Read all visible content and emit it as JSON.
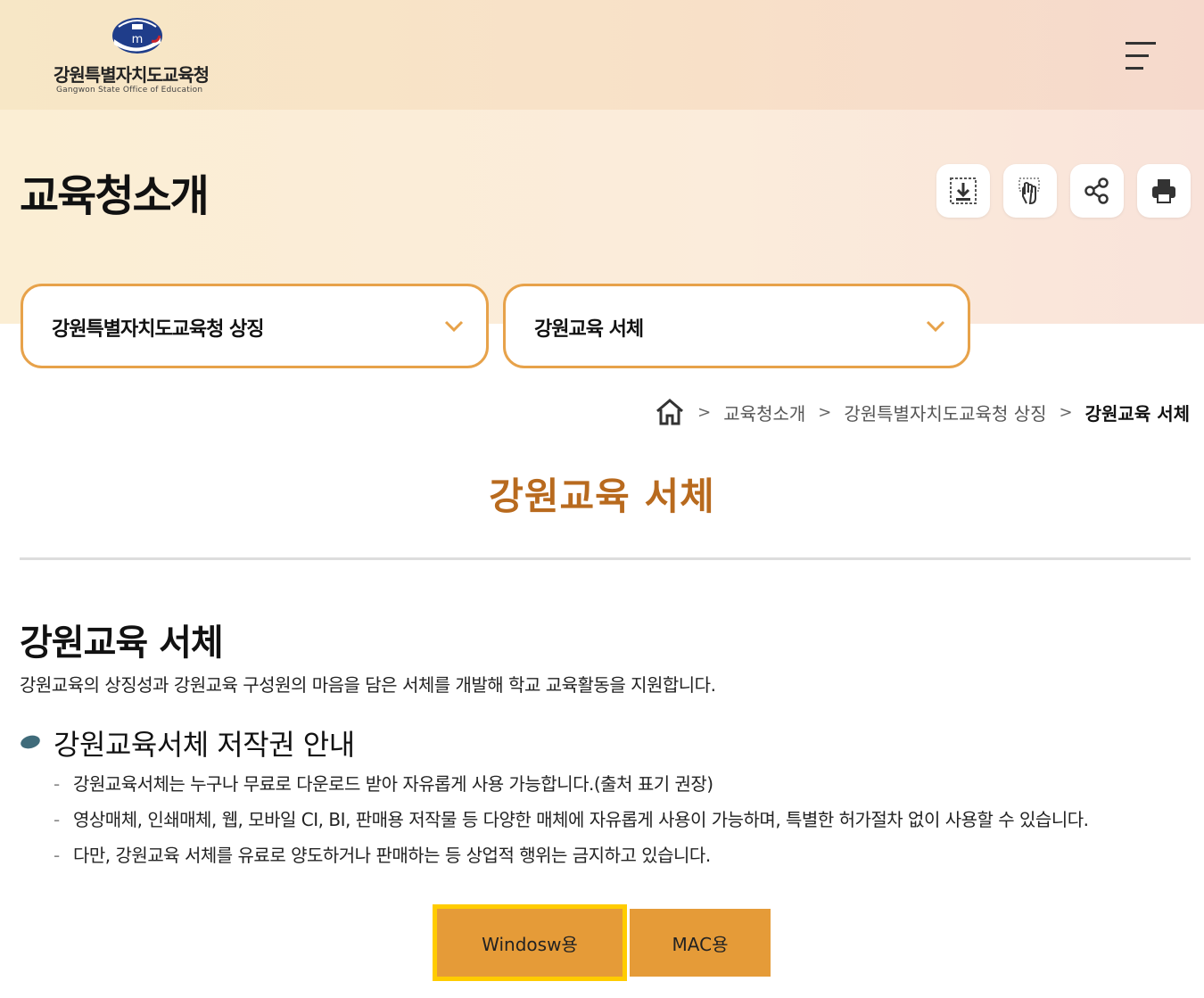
{
  "header": {
    "logo_name": "강원특별자치도교육청",
    "logo_sub": "Gangwon State Office of Education",
    "menu_icon": "hamburger-menu-icon"
  },
  "hero": {
    "title": "교육청소개",
    "tools": [
      {
        "name": "download-icon"
      },
      {
        "name": "touch-icon"
      },
      {
        "name": "share-icon"
      },
      {
        "name": "print-icon"
      }
    ]
  },
  "selects": {
    "first": "강원특별자치도교육청 상징",
    "second": "강원교육 서체"
  },
  "breadcrumb": {
    "home_icon": "home-icon",
    "items": [
      "교육청소개",
      "강원특별자치도교육청 상징",
      "강원교육 서체"
    ]
  },
  "content": {
    "section_title": "강원교육 서체",
    "heading": "강원교육 서체",
    "description": "강원교육의 상징성과 강원교육 구성원의 마음을 담은 서체를 개발해 학교 교육활동을 지원합니다.",
    "subheading": "강원교육서체 저작권 안내",
    "notes": [
      "강원교육서체는 누구나 무료로 다운로드 받아 자유롭게 사용 가능합니다.(출처 표기 권장)",
      "영상매체, 인쇄매체, 웹, 모바일 CI, BI, 판매용 저작물 등 다양한 매체에 자유롭게 사용이 가능하며, 특별한 허가절차 없이 사용할 수 있습니다.",
      "다만, 강원교육 서체를 유료로 양도하거나 판매하는 등 상업적 행위는 금지하고 있습니다."
    ],
    "buttons": {
      "windows": "Windosw용",
      "mac": "MAC용"
    }
  },
  "colors": {
    "accent": "#e59b38",
    "select_border": "#e7a24a",
    "title_brown": "#b86a1e",
    "focus_ring": "#ffcc00"
  }
}
